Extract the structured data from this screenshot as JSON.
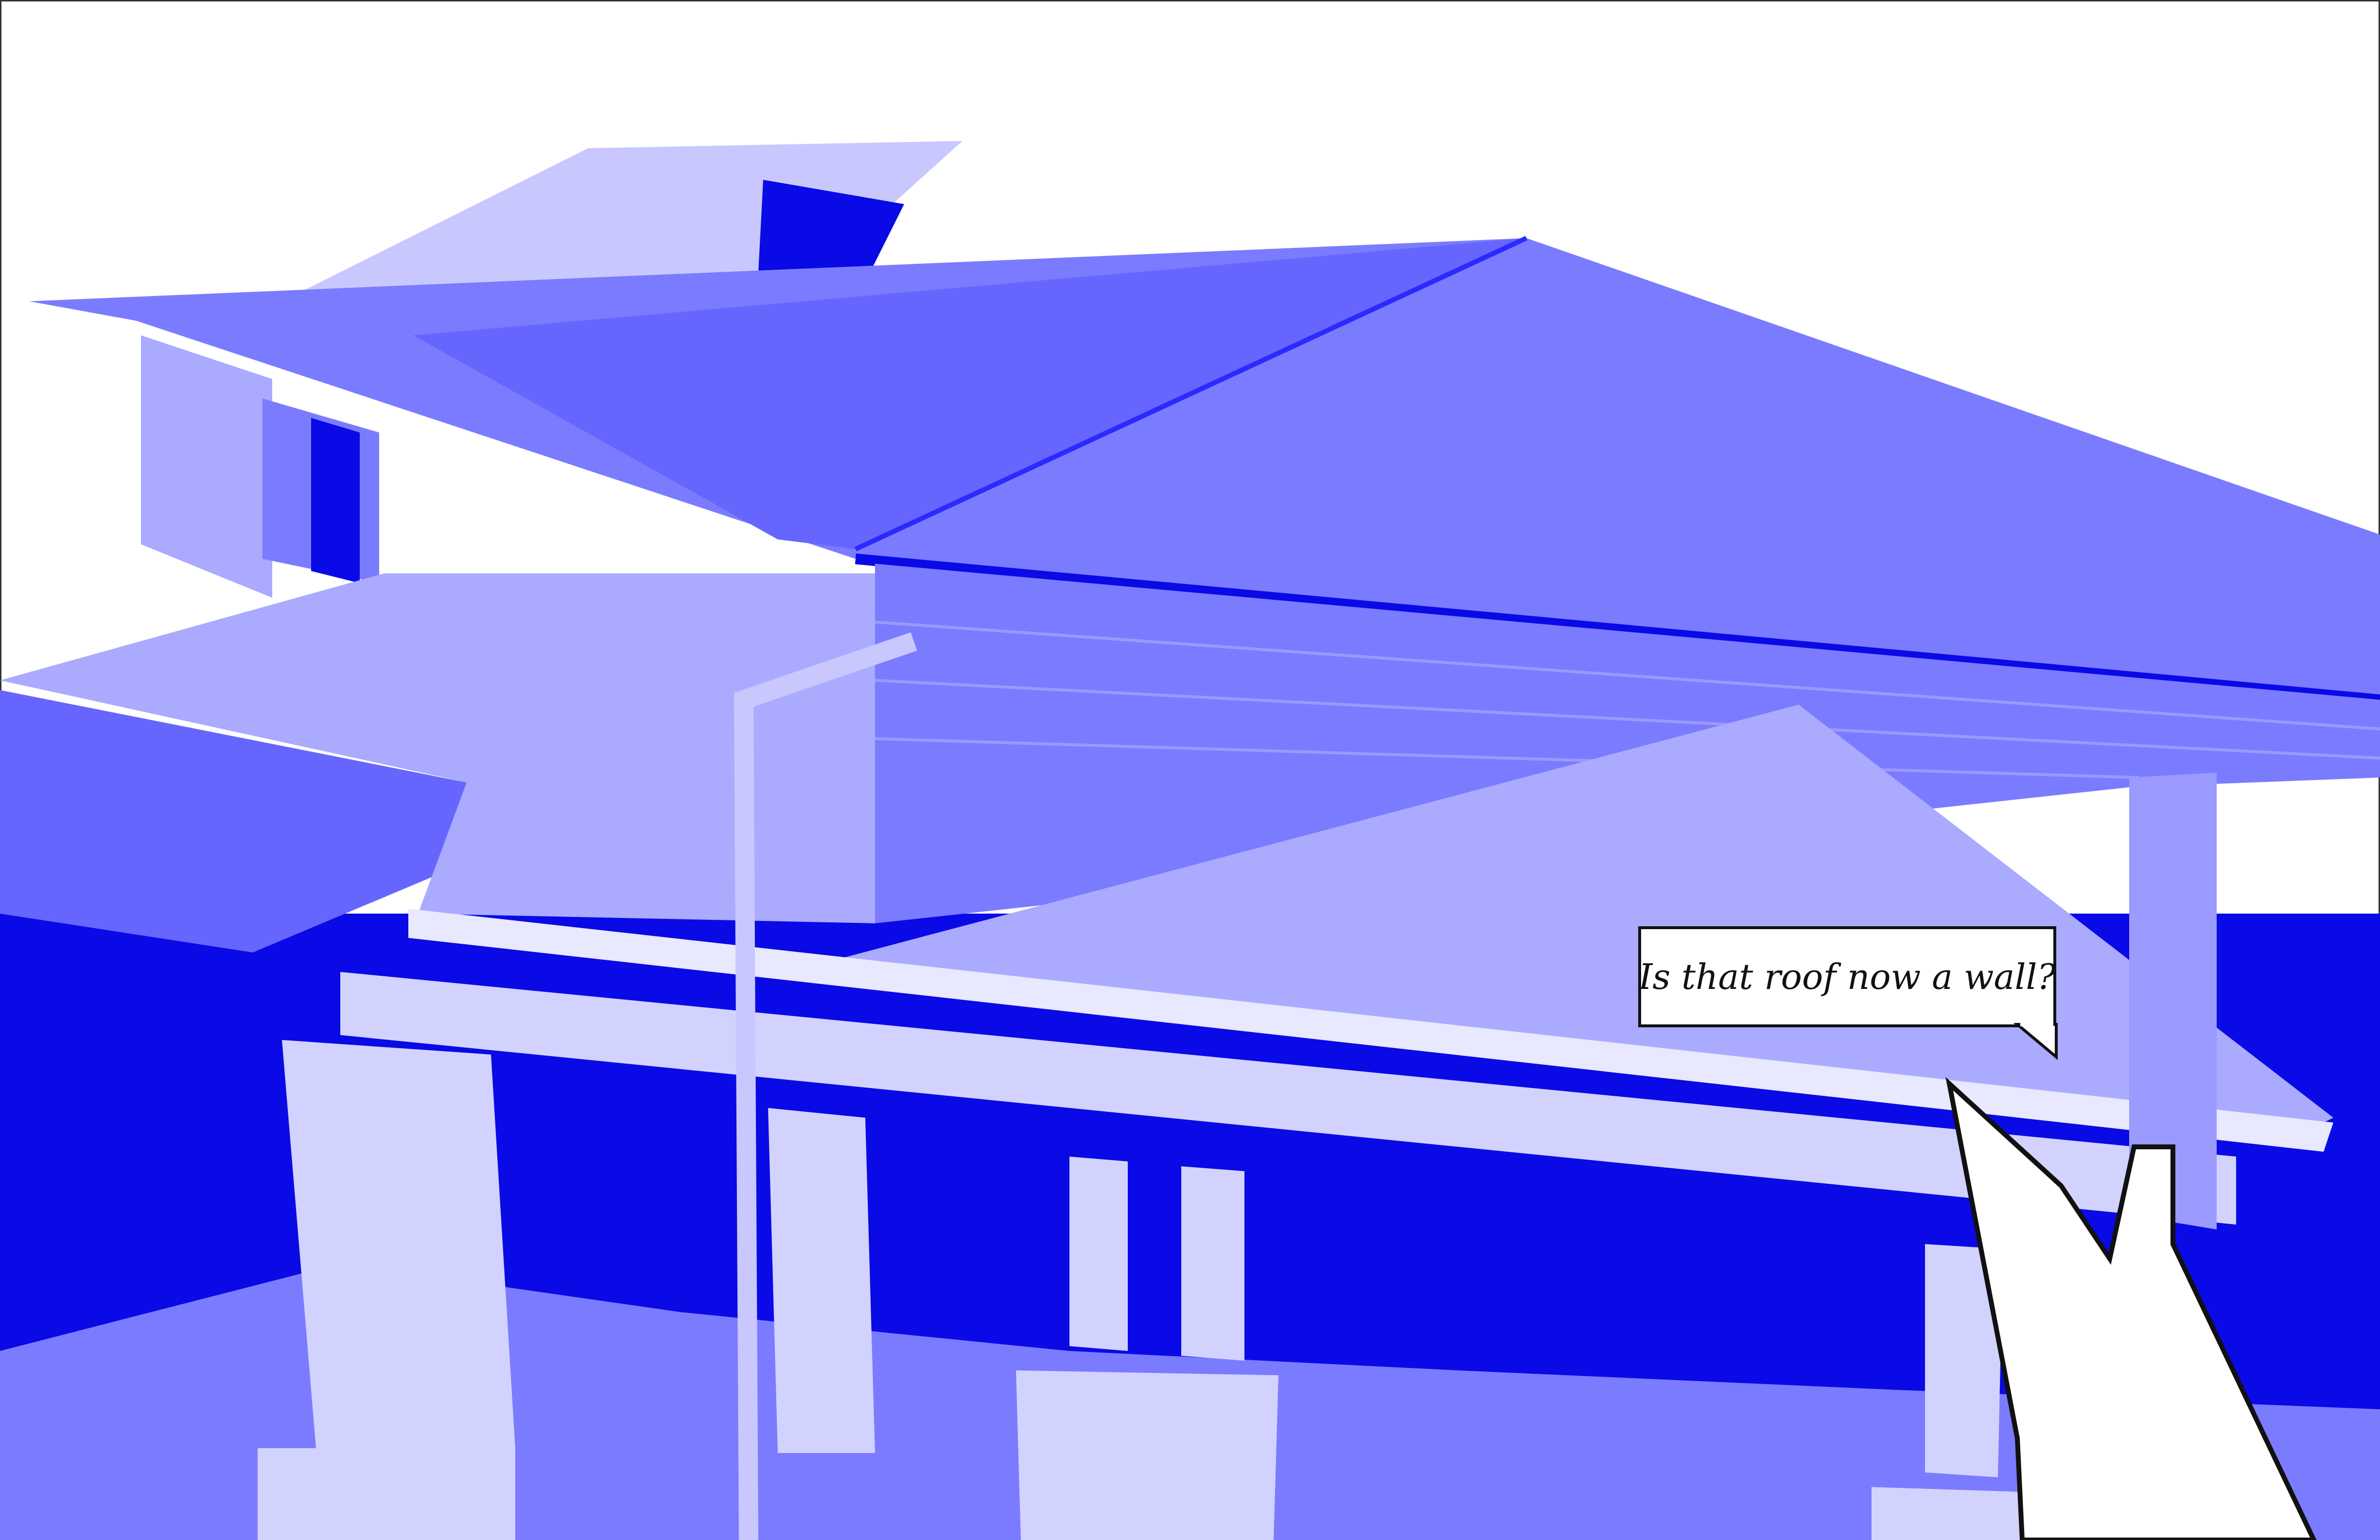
{
  "callout": {
    "text": "Is that roof now a wall?"
  },
  "colors": {
    "background": "#ffffff",
    "deep_blue": "#0a0ae6",
    "roof_mid": "#7b7bff",
    "roof_light": "#aaaaff",
    "wall_pale": "#d2d2ff",
    "outline": "#111111"
  },
  "icons": {
    "hand_cursor": "pointing-hand-cursor-icon"
  }
}
